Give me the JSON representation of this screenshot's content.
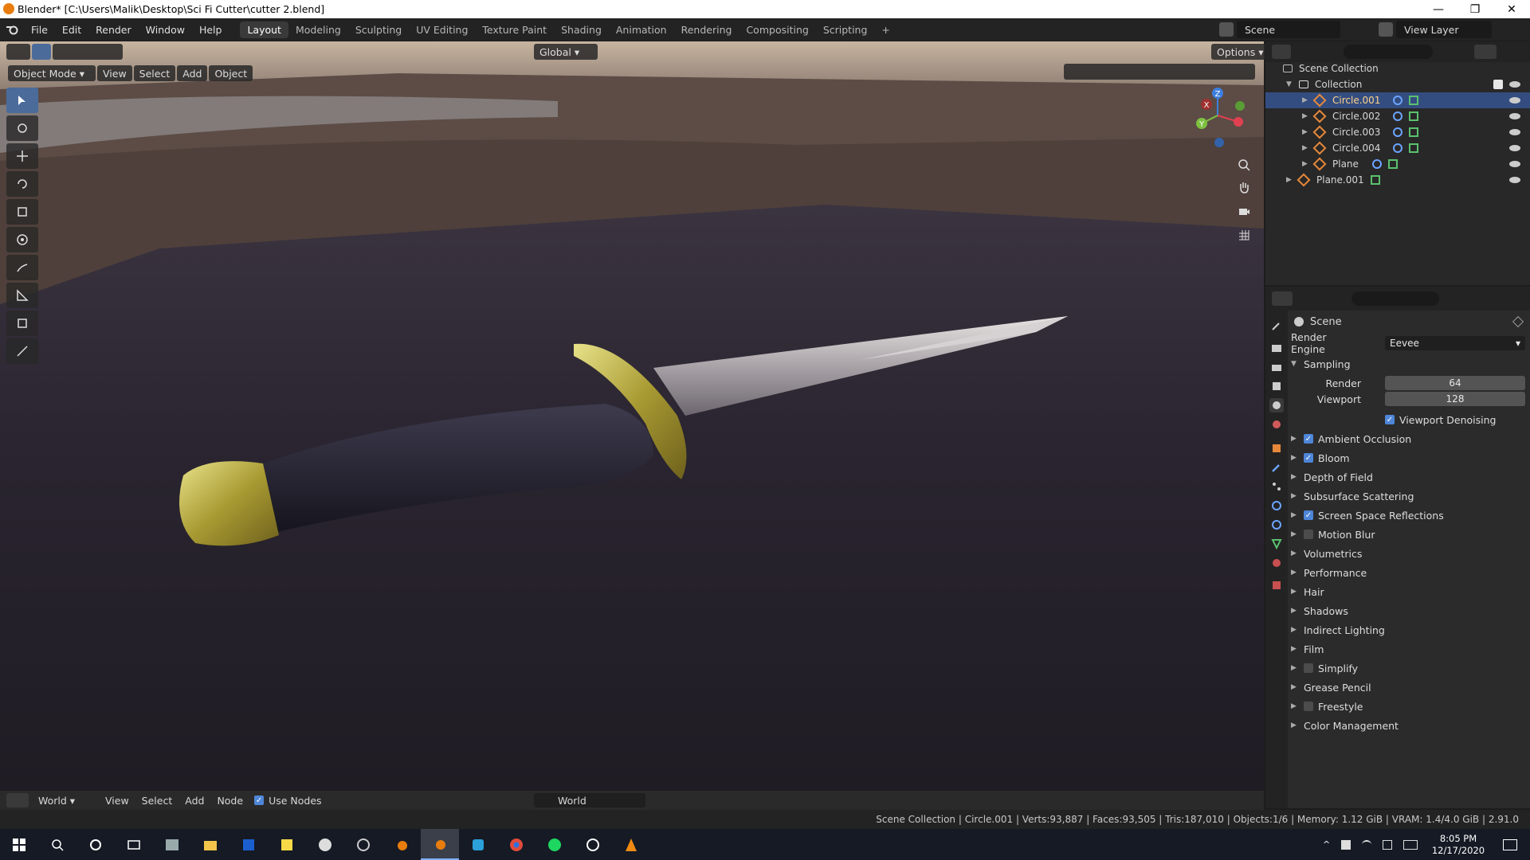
{
  "window": {
    "title": "Blender* [C:\\Users\\Malik\\Desktop\\Sci Fi Cutter\\cutter 2.blend]",
    "min": "—",
    "max": "❐",
    "close": "✕"
  },
  "menubar": {
    "items": [
      "File",
      "Edit",
      "Render",
      "Window",
      "Help"
    ],
    "workspaces": [
      "Layout",
      "Modeling",
      "Sculpting",
      "UV Editing",
      "Texture Paint",
      "Shading",
      "Animation",
      "Rendering",
      "Compositing",
      "Scripting"
    ],
    "add_tab": "+",
    "scene": "Scene",
    "view_layer": "View Layer"
  },
  "viewport": {
    "mode": "Object Mode",
    "menus": [
      "View",
      "Select",
      "Add",
      "Object"
    ],
    "orientation": "Global",
    "options": "Options",
    "gizmo": {
      "x": "X",
      "y": "Y",
      "z": "Z"
    }
  },
  "outliner": {
    "root": "Scene Collection",
    "collection": "Collection",
    "objects": [
      "Circle.001",
      "Circle.002",
      "Circle.003",
      "Circle.004",
      "Plane"
    ],
    "extra": "Plane.001"
  },
  "properties": {
    "header": "Scene",
    "render_engine_label": "Render Engine",
    "render_engine": "Eevee",
    "sampling": "Sampling",
    "render_label": "Render",
    "render_value": "64",
    "viewport_label": "Viewport",
    "viewport_value": "128",
    "viewport_denoising": "Viewport Denoising",
    "panels": [
      {
        "label": "Ambient Occlusion",
        "check": "on"
      },
      {
        "label": "Bloom",
        "check": "on"
      },
      {
        "label": "Depth of Field",
        "check": "none"
      },
      {
        "label": "Subsurface Scattering",
        "check": "none"
      },
      {
        "label": "Screen Space Reflections",
        "check": "on"
      },
      {
        "label": "Motion Blur",
        "check": "off"
      },
      {
        "label": "Volumetrics",
        "check": "none"
      },
      {
        "label": "Performance",
        "check": "none"
      },
      {
        "label": "Hair",
        "check": "none"
      },
      {
        "label": "Shadows",
        "check": "none"
      },
      {
        "label": "Indirect Lighting",
        "check": "none"
      },
      {
        "label": "Film",
        "check": "none"
      },
      {
        "label": "Simplify",
        "check": "off"
      },
      {
        "label": "Grease Pencil",
        "check": "none"
      },
      {
        "label": "Freestyle",
        "check": "off"
      },
      {
        "label": "Color Management",
        "check": "none"
      }
    ]
  },
  "shader_bar": {
    "world": "World",
    "menus": [
      "View",
      "Select",
      "Add",
      "Node"
    ],
    "use_nodes": "Use Nodes",
    "world_field": "World"
  },
  "status": "Scene Collection | Circle.001 | Verts:93,887 | Faces:93,505 | Tris:187,010 | Objects:1/6 | Memory: 1.12 GiB | VRAM: 1.4/4.0 GiB | 2.91.0",
  "taskbar": {
    "time": "8:05 PM",
    "date": "12/17/2020"
  },
  "colors": {
    "accent": "#4e86d8",
    "selection": "#334d80",
    "object_orange": "#e6883a",
    "mesh_green": "#5ac16e"
  }
}
